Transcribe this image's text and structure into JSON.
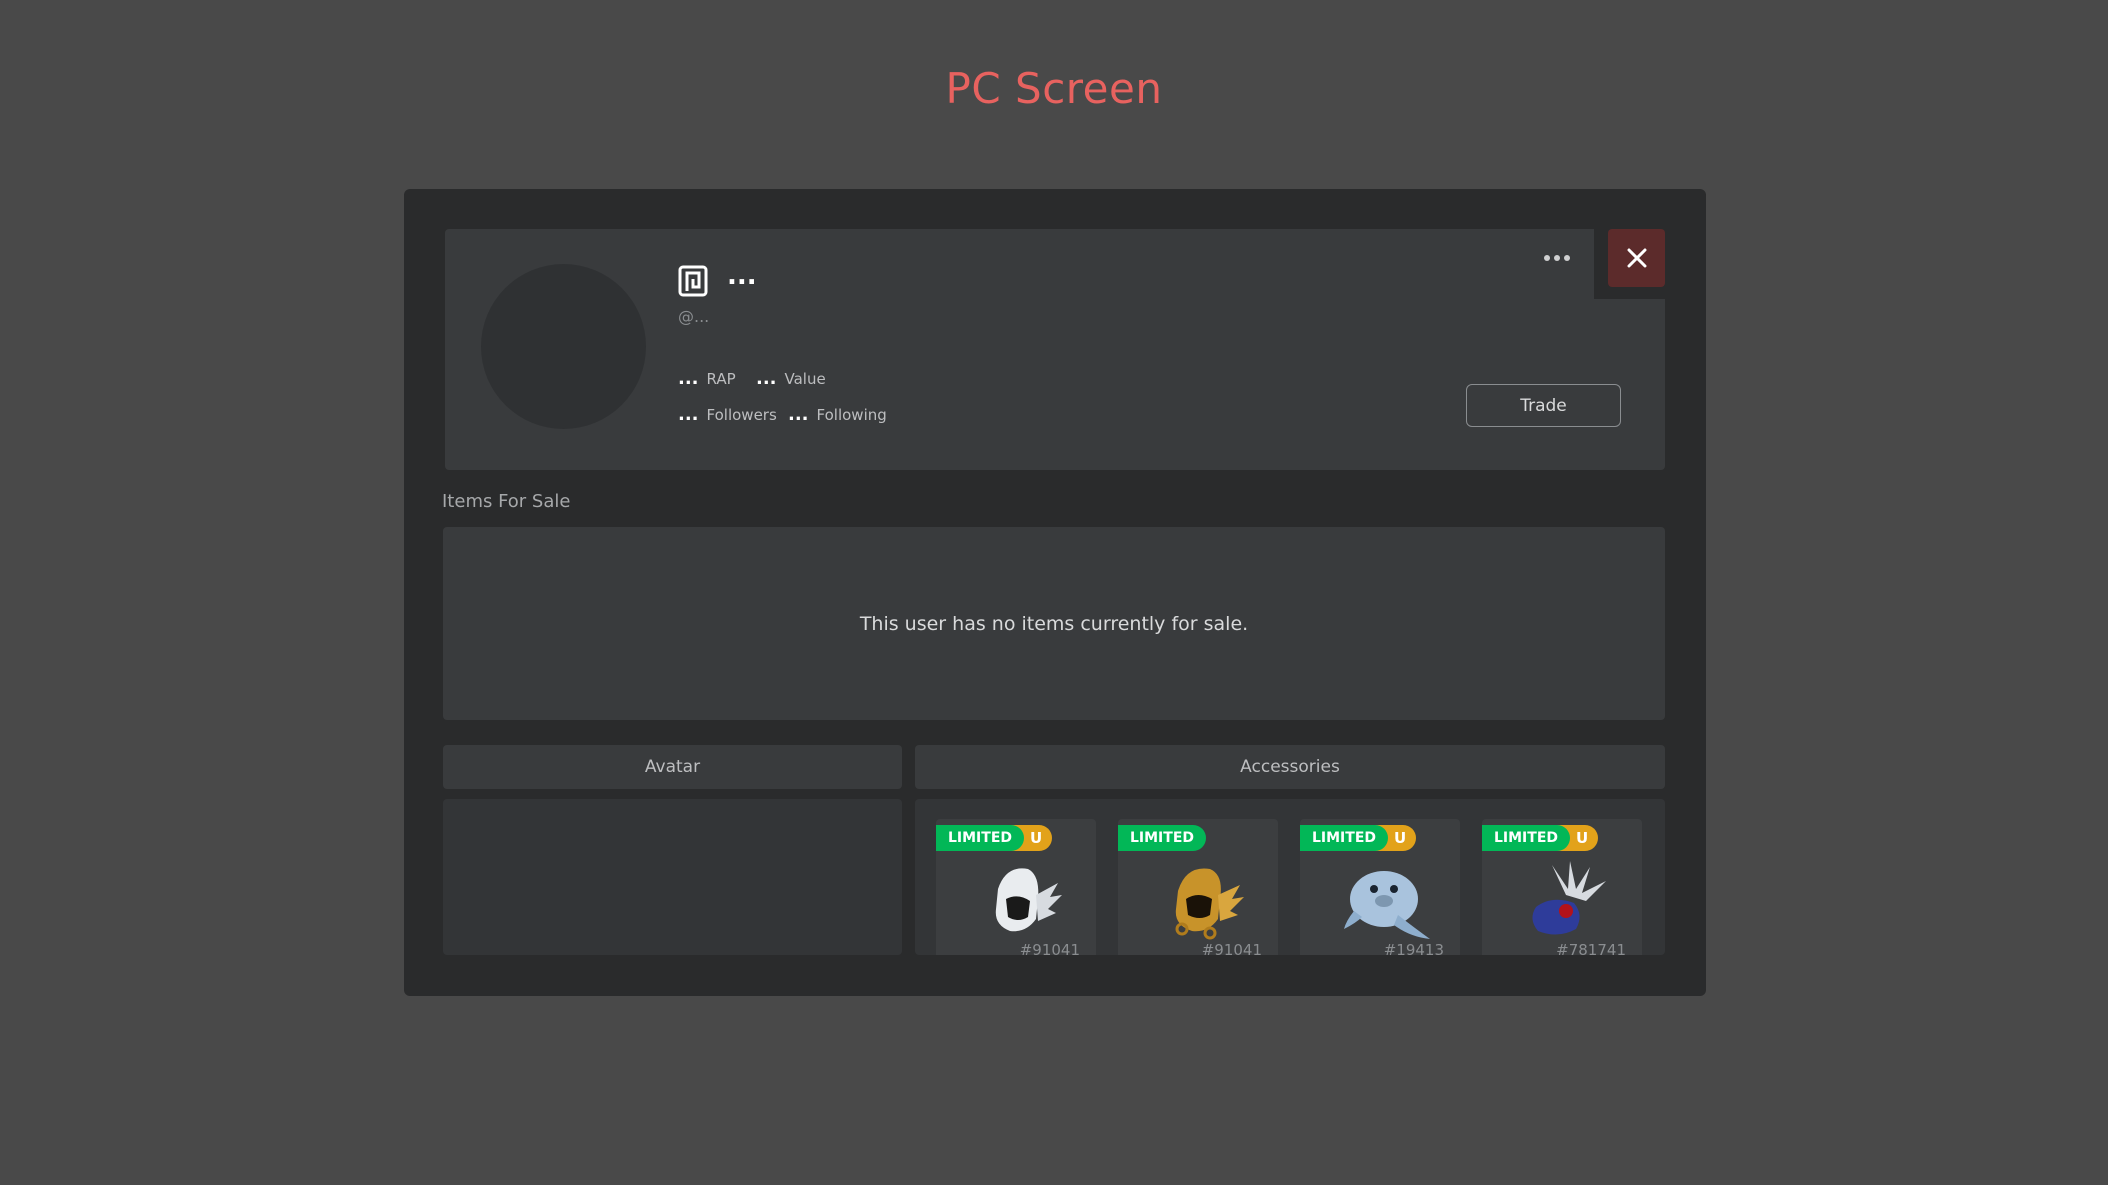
{
  "page": {
    "title": "PC Screen"
  },
  "profile": {
    "display_name": "...",
    "username": "@...",
    "stats": {
      "rap_value": "...",
      "rap_label": "RAP",
      "value_value": "...",
      "value_label": "Value",
      "followers_value": "...",
      "followers_label": "Followers",
      "following_value": "...",
      "following_label": "Following"
    },
    "trade_label": "Trade"
  },
  "items_for_sale": {
    "heading": "Items For Sale",
    "empty_message": "This user has no items currently for sale."
  },
  "tabs": {
    "avatar": "Avatar",
    "accessories": "Accessories"
  },
  "accessories": [
    {
      "badge": "LIMITED",
      "unique": "U",
      "serial": "#91041",
      "icon": "dominus-white-icon"
    },
    {
      "badge": "LIMITED",
      "unique": "",
      "serial": "#91041",
      "icon": "dominus-gold-icon"
    },
    {
      "badge": "LIMITED",
      "unique": "U",
      "serial": "#19413",
      "icon": "seal-hat-icon"
    },
    {
      "badge": "LIMITED",
      "unique": "U",
      "serial": "#781741",
      "icon": "feathered-hat-icon"
    }
  ],
  "colors": {
    "title": "#e8625f",
    "limited_badge": "#02b757",
    "unique_badge": "#e2a21a",
    "close_button": "#5c2b2b"
  }
}
